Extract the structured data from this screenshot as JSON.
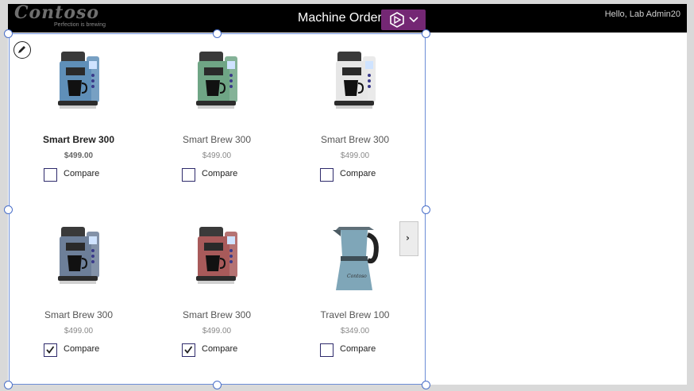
{
  "header": {
    "logo_text": "Contoso",
    "logo_tagline": "Perfection is brewing",
    "title": "Machine Order",
    "greeting": "Hello, Lab Admin20"
  },
  "gallery": {
    "items": [
      {
        "name": "Smart Brew 300",
        "price": "$499.00",
        "compare_label": "Compare",
        "checked": false,
        "color": "#5f8fb8",
        "selected": true
      },
      {
        "name": "Smart Brew 300",
        "price": "$499.00",
        "compare_label": "Compare",
        "checked": false,
        "color": "#6fa585",
        "selected": false
      },
      {
        "name": "Smart Brew 300",
        "price": "$499.00",
        "compare_label": "Compare",
        "checked": false,
        "color": "#e6e6e6",
        "selected": false
      },
      {
        "name": "Smart Brew 300",
        "price": "$499.00",
        "compare_label": "Compare",
        "checked": true,
        "color": "#6d7f99",
        "selected": false
      },
      {
        "name": "Smart Brew 300",
        "price": "$499.00",
        "compare_label": "Compare",
        "checked": true,
        "color": "#a85a5a",
        "selected": false
      },
      {
        "name": "Travel Brew 100",
        "price": "$349.00",
        "compare_label": "Compare",
        "checked": false,
        "color": "#7fa6b8",
        "selected": false
      }
    ]
  },
  "icons": {
    "edit": "pencil-icon",
    "next": "chevron-right-icon",
    "app_switch": "power-apps-icon",
    "dropdown": "chevron-down-icon"
  },
  "colors": {
    "header_bg": "#000000",
    "accent": "#742774",
    "selection": "#6b8cd6",
    "checkbox_border": "#2e2a6b"
  }
}
